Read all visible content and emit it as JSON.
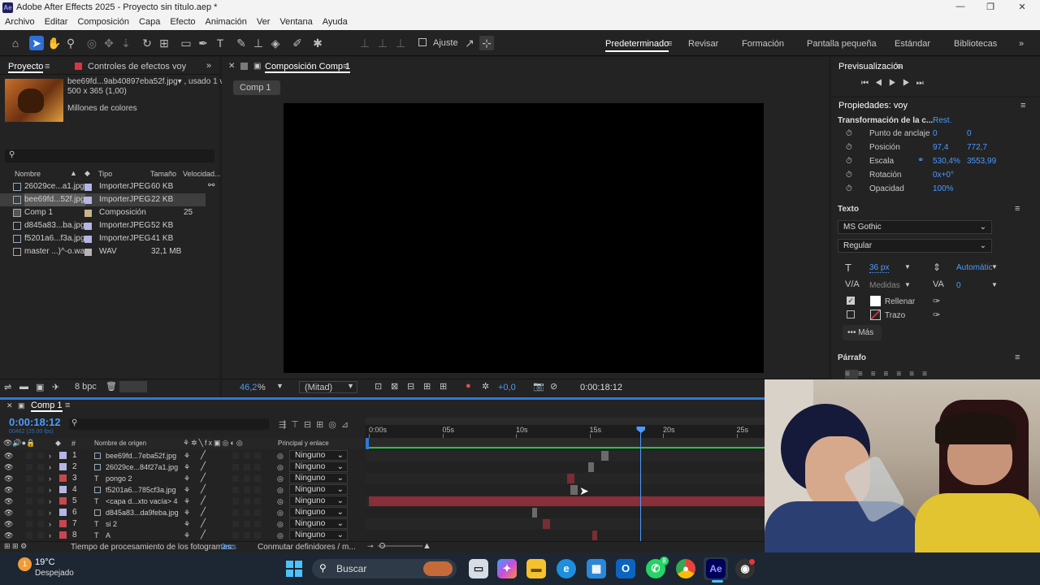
{
  "window": {
    "title": "Adobe After Effects 2025 - Proyecto sin título.aep *",
    "minimize": "—",
    "maximize": "❐",
    "close": "✕"
  },
  "menu": [
    "Archivo",
    "Editar",
    "Composición",
    "Capa",
    "Efecto",
    "Animación",
    "Ver",
    "Ventana",
    "Ayuda"
  ],
  "toolbar": {
    "snap_label": "Ajuste",
    "workspaces": [
      "Predeterminado",
      "Revisar",
      "Formación",
      "Pantalla pequeña",
      "Estándar",
      "Bibliotecas"
    ]
  },
  "project": {
    "tab_label": "Proyecto",
    "effects_tab": "Controles de efectos voy",
    "selected_name": "bee69fd...9ab40897eba52f.jpg▾ , usado 1 vez",
    "selected_dims": "500 x 365 (1,00)",
    "selected_colors": "Millones de colores",
    "search_placeholder": "",
    "columns": [
      "Nombre",
      "Tipo",
      "Tamaño",
      "Velocidad..."
    ],
    "items": [
      {
        "name": "26029ce...a1.jpg",
        "type": "ImporterJPEG",
        "size": "60 KB",
        "speed": "",
        "color": "#b5b5e6"
      },
      {
        "name": "bee69fd...52f.jpg",
        "type": "ImporterJPEG",
        "size": "22 KB",
        "speed": "",
        "color": "#b5b5e6"
      },
      {
        "name": "Comp 1",
        "type": "Composición",
        "size": "",
        "speed": "25",
        "color": "#c8b68a"
      },
      {
        "name": "d845a83...ba.jpg",
        "type": "ImporterJPEG",
        "size": "52 KB",
        "speed": "",
        "color": "#b5b5e6"
      },
      {
        "name": "f5201a6...f3a.jpg",
        "type": "ImporterJPEG",
        "size": "41 KB",
        "speed": "",
        "color": "#b5b5e6"
      },
      {
        "name": "master ...)^-o.wav",
        "type": "WAV",
        "size": "32,1 MB",
        "speed": "",
        "color": "#b5b5b5"
      }
    ],
    "bpc": "8 bpc"
  },
  "composition": {
    "tab_label": "Composición Comp 1",
    "flow_tab": "Comp 1",
    "zoom": "46,2",
    "zoom_unit": "%",
    "resolution": "(Mitad)",
    "exposure": "+0,0",
    "timecode": "0:00:18:12"
  },
  "preview": {
    "title": "Previsualización"
  },
  "properties": {
    "title": "Propiedades: voy",
    "transform_label": "Transformación de la c...",
    "reset": "Rest.",
    "rows": [
      {
        "label": "Punto de anclaje",
        "v1": "0",
        "v2": "0"
      },
      {
        "label": "Posición",
        "v1": "97,4",
        "v2": "772,7"
      },
      {
        "label": "Escala",
        "v1": "530,4%",
        "v2": "3553,99"
      },
      {
        "label": "Rotación",
        "v1": "0x+0°",
        "v2": ""
      },
      {
        "label": "Opacidad",
        "v1": "100%",
        "v2": ""
      }
    ],
    "text_section": "Texto",
    "font": "MS Gothic",
    "style": "Regular",
    "font_size": "36 px",
    "leading": "Automátic",
    "kerning": "Medidas",
    "tracking": "0",
    "fill_label": "Rellenar",
    "stroke_label": "Trazo",
    "more_label": "Más",
    "paragraph": "Párrafo"
  },
  "timeline": {
    "tab_label": "Comp 1",
    "timecode": "0:00:18:12",
    "frame_info": "00462 (25.00 fps)",
    "col_source": "Nombre de origen",
    "col_parent": "Principal y enlace",
    "ruler": [
      "0:00s",
      "05s",
      "10s",
      "15s",
      "20s",
      "25s"
    ],
    "playhead_seconds": 18.48,
    "layers": [
      {
        "num": "1",
        "kind": "img",
        "name": "bee69fd...7eba52f.jpg",
        "parent": "Ninguno",
        "color": "#b5b5e6",
        "bar_start": 15.8,
        "bar_end": 16.3,
        "bar_color": "#6a6a6a"
      },
      {
        "num": "2",
        "kind": "img",
        "name": "26029ce...84f27a1.jpg",
        "parent": "Ninguno",
        "color": "#b5b5e6",
        "bar_start": 14.9,
        "bar_end": 15.3,
        "bar_color": "#6a6a6a"
      },
      {
        "num": "3",
        "kind": "T",
        "name": "pongo 2",
        "parent": "Ninguno",
        "color": "#c8474f",
        "bar_start": 13.5,
        "bar_end": 14.0,
        "bar_color": "#7a2d33"
      },
      {
        "num": "4",
        "kind": "img",
        "name": "f5201a6...785cf3a.jpg",
        "parent": "Ninguno",
        "color": "#b5b5e6",
        "bar_start": 13.7,
        "bar_end": 14.2,
        "bar_color": "#6a6a6a"
      },
      {
        "num": "5",
        "kind": "T",
        "name": "<capa d...xto vacía> 4",
        "parent": "Ninguno",
        "color": "#c8474f",
        "bar_start": 0.0,
        "bar_end": 27.0,
        "bar_color": "#8a2e38"
      },
      {
        "num": "6",
        "kind": "img",
        "name": "d845a83...da9feba.jpg",
        "parent": "Ninguno",
        "color": "#b5b5e6",
        "bar_start": 11.1,
        "bar_end": 11.4,
        "bar_color": "#6a6a6a"
      },
      {
        "num": "7",
        "kind": "T",
        "name": "si 2",
        "parent": "Ninguno",
        "color": "#c8474f",
        "bar_start": 11.8,
        "bar_end": 12.3,
        "bar_color": "#7a2d33"
      },
      {
        "num": "8",
        "kind": "T",
        "name": "A",
        "parent": "Ninguno",
        "color": "#c8474f",
        "bar_start": 15.2,
        "bar_end": 15.5,
        "bar_color": "#7a2d33"
      }
    ],
    "status_label": "Tiempo de procesamiento de los fotogramas:",
    "status_value": "0ms",
    "toggle_label": "Conmutar definidores / m..."
  },
  "taskbar": {
    "temperature": "19°C",
    "weather": "Despejado",
    "search": "Buscar",
    "ae_label": "Ae",
    "whatsapp_badge": "8"
  }
}
